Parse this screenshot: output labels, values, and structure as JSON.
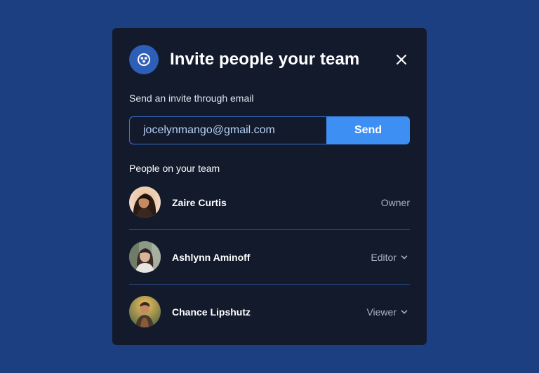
{
  "modal": {
    "title": "Invite people your team",
    "invite_label": "Send an invite through email",
    "email_value": "jocelynmango@gmail.com",
    "send_label": "Send",
    "people_label": "People on your team"
  },
  "people": [
    {
      "name": "Zaire Curtis",
      "role": "Owner"
    },
    {
      "name": "Ashlynn Aminoff",
      "role": "Editor"
    },
    {
      "name": "Chance Lipshutz",
      "role": "Viewer"
    }
  ],
  "colors": {
    "background": "#1b3f80",
    "modal": "#121a2c",
    "accent": "#3e8ff4",
    "input_border": "#3c74d6"
  }
}
